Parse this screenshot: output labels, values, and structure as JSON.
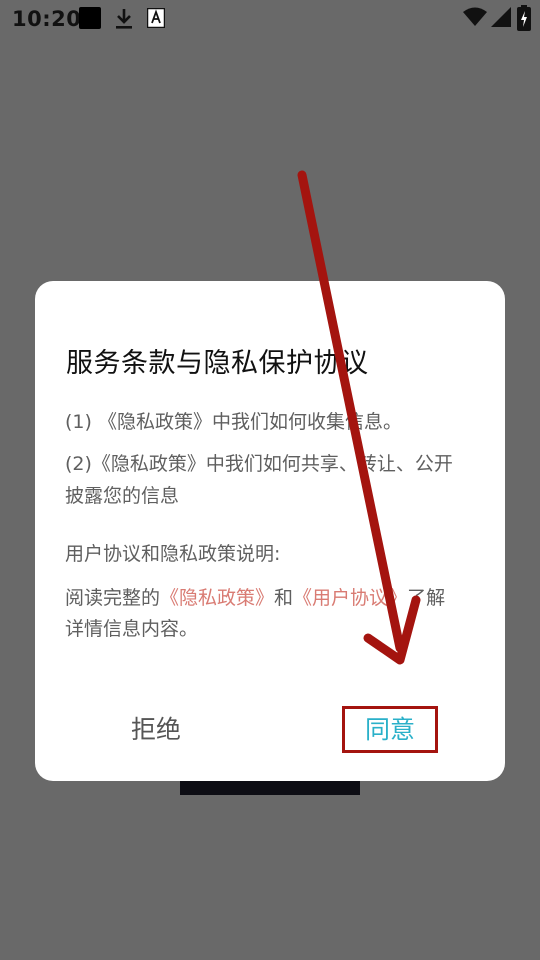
{
  "status_bar": {
    "time": "10:20"
  },
  "dialog": {
    "title": "服务条款与隐私保护协议",
    "line1": "(1) 《隐私政策》中我们如何收集信息。",
    "line2a": "(2)《隐私政策》中我们如何共享、转让、公开",
    "line2b": "披露您的信息",
    "section_heading": "用户协议和隐私政策说明:",
    "read_prefix": "阅读完整的",
    "privacy_link": "《隐私政策》",
    "and_text": "和",
    "user_agreement_link": "《用户协议》",
    "read_suffix": "了解",
    "line_last": "详情信息内容。",
    "reject_label": "拒绝",
    "agree_label": "同意"
  },
  "colors": {
    "overlay": "#696969",
    "link": "#d97b73",
    "agree": "#2ab0c9",
    "annotation": "#a4140f"
  }
}
